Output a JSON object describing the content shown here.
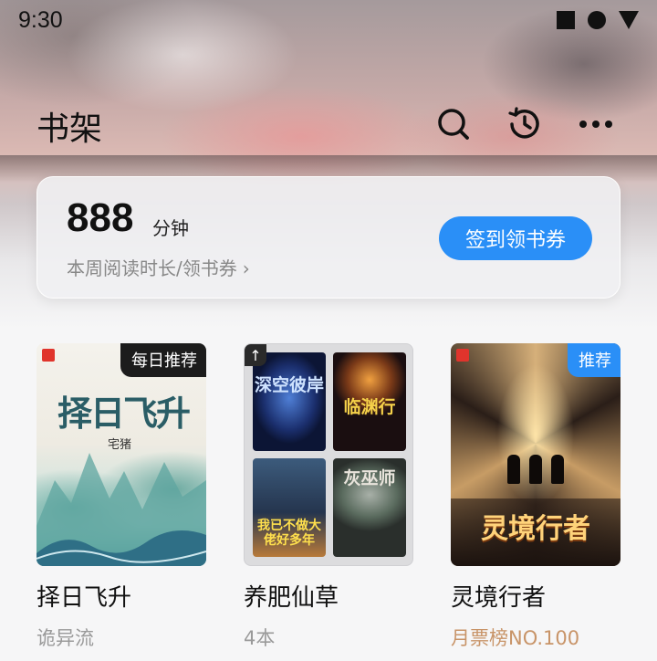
{
  "status_bar": {
    "time": "9:30"
  },
  "header": {
    "title": "书架"
  },
  "reading": {
    "minutes": "888",
    "unit": "分钟",
    "description": "本周阅读时长/领书券",
    "chevron": "›",
    "checkin_label": "签到领书券"
  },
  "books": [
    {
      "title": "择日飞升",
      "subtitle": "诡异流",
      "badge": "每日推荐",
      "cover_title": "择日飞升",
      "cover_author": "宅猪"
    },
    {
      "title": "养肥仙草",
      "subtitle": "4本",
      "pin_icon": "↑",
      "mini_covers": [
        "深空彼岸",
        "临渊行",
        "我已不做大佬好多年",
        "灰巫师"
      ]
    },
    {
      "title": "灵境行者",
      "subtitle": "月票榜NO.100",
      "badge": "推荐",
      "cover_title": "灵境行者"
    }
  ],
  "icons": {
    "search": "search-icon",
    "history": "history-icon",
    "more": "more-icon"
  },
  "colors": {
    "accent": "#2a8ff7",
    "rank_text": "#c89468",
    "badge_dark": "#1c1c1c"
  }
}
